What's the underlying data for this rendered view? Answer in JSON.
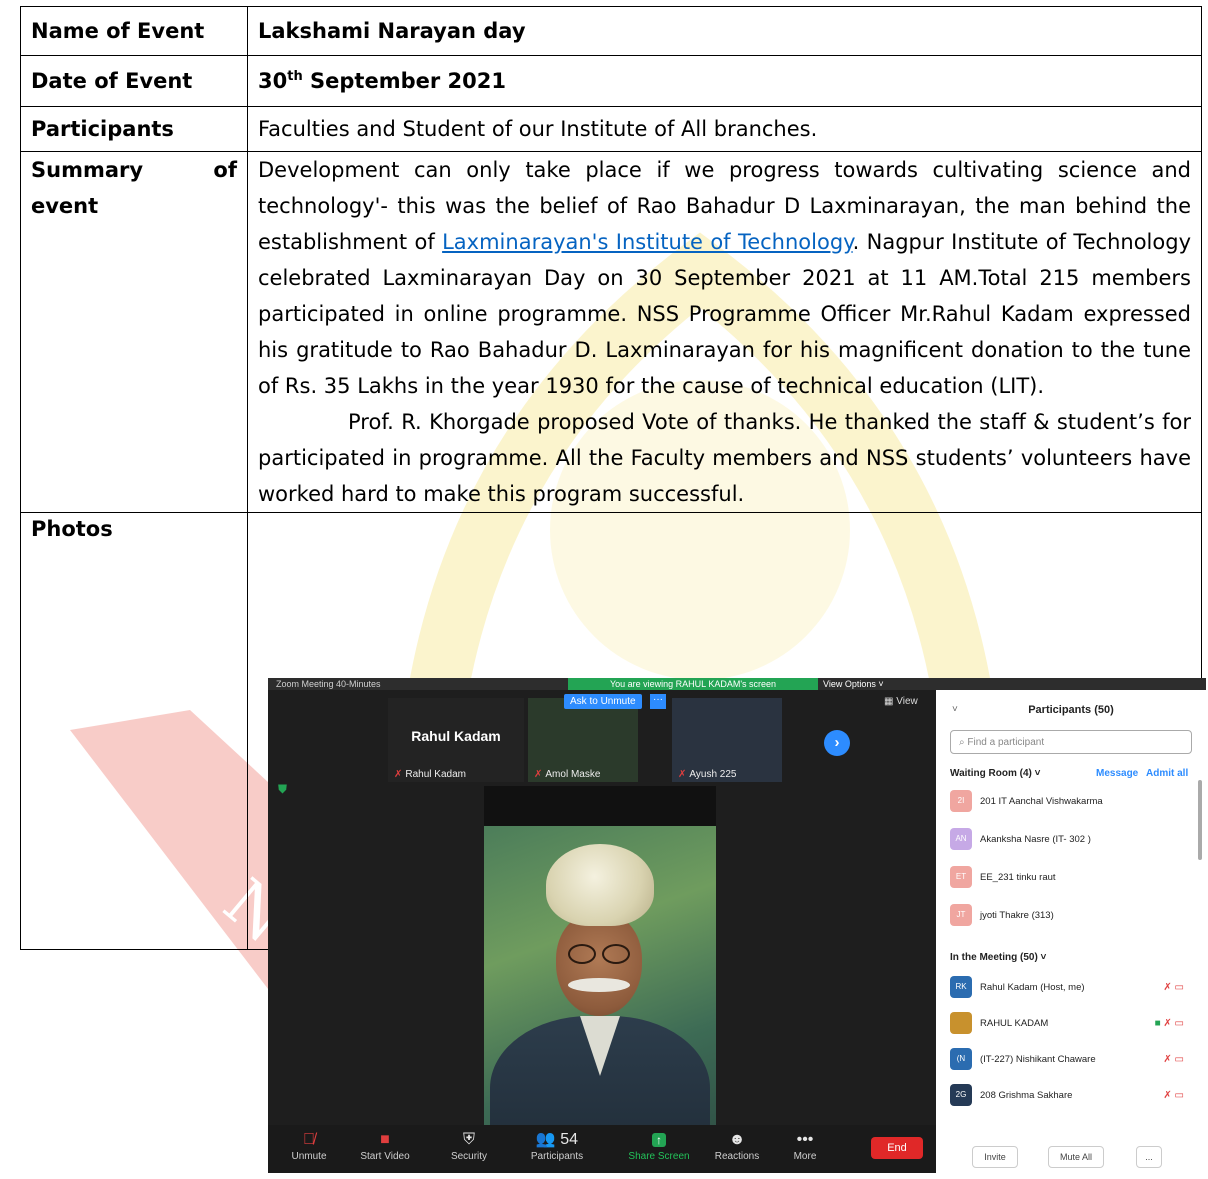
{
  "colors": {
    "watermark_red": "#f5b7b2",
    "watermark_yellow": "#fbf3c8",
    "link": "#0563c1",
    "zoom_blue": "#2d8cff",
    "zoom_green": "#23a454",
    "zoom_end": "#e02828"
  },
  "watermark": {
    "text": "Na"
  },
  "report": {
    "row1": {
      "label": "Name of Event",
      "value": "Lakshami Narayan day"
    },
    "row2": {
      "label": "Date of Event",
      "value_day": "30",
      "value_sup": "th",
      "value_rest": " September 2021"
    },
    "row3": {
      "label": "Participants",
      "value": "Faculties and Student of our Institute of All branches."
    },
    "row4": {
      "label_a": "Summary",
      "label_b": "of",
      "label_c": "event",
      "p1_before": "Development can only take place if we progress towards cultivating science and technology'- this was the belief of Rao Bahadur D Laxminarayan, the man behind the establishment of ",
      "p1_link": "Laxminarayan's Institute of Technology",
      "p1_after": ". Nagpur Institute of Technology celebrated Laxminarayan Day on 30 September 2021 at 11 AM.Total 215 members participated in online programme. NSS Programme Officer Mr.Rahul Kadam expressed his gratitude to Rao Bahadur D. Laxminarayan for his magnificent donation to the tune of Rs. 35 Lakhs in the year 1930 for the cause of technical education (LIT).",
      "p2": "Prof. R. Khorgade proposed Vote of thanks. He thanked the staff & student’s for participated in programme. All the Faculty members and NSS students’ volunteers have worked hard to make this program successful."
    },
    "row5": {
      "label": "Photos"
    }
  },
  "zoom": {
    "title": "Zoom Meeting 40-Minutes",
    "banner": "You are viewing RAHUL KADAM's screen",
    "view_options": "View Options ˅",
    "view_label": "View",
    "ask_unmute": "Ask to Unmute",
    "thumbs": [
      {
        "big": "Rahul Kadam",
        "tag": "Rahul Kadam"
      },
      {
        "big": "",
        "tag": "Amol Maske"
      },
      {
        "big": "",
        "tag": "Ayush 225"
      }
    ],
    "toolbar": [
      {
        "icon": "microphone-muted-icon",
        "glyph": "🎙",
        "label": "Unmute"
      },
      {
        "icon": "video-off-icon",
        "glyph": "■",
        "label": "Start Video"
      },
      {
        "icon": "shield-icon",
        "glyph": "⛨",
        "label": "Security"
      },
      {
        "icon": "participants-icon",
        "glyph": "👥 54",
        "label": "Participants"
      },
      {
        "icon": "share-screen-icon",
        "glyph": "↑",
        "label": "Share Screen"
      },
      {
        "icon": "reactions-icon",
        "glyph": "☻",
        "label": "Reactions"
      },
      {
        "icon": "more-icon",
        "glyph": "•••",
        "label": "More"
      }
    ],
    "end_label": "End",
    "panel": {
      "title": "Participants (50)",
      "search_placeholder": "Find a participant",
      "waiting": "Waiting Room (4)  ˅",
      "message": "Message",
      "admit_all": "Admit all",
      "waiting_list": [
        {
          "initials": "2I",
          "name": "201 IT Aanchal Vishwakarma",
          "color": "#f0a6a0"
        },
        {
          "initials": "AN",
          "name": "Akanksha Nasre (IT- 302 )",
          "color": "#c6a9e6"
        },
        {
          "initials": "ET",
          "name": "EE_231 tinku raut",
          "color": "#f0a6a0"
        },
        {
          "initials": "JT",
          "name": "jyoti Thakre (313)",
          "color": "#f0a6a0"
        }
      ],
      "in_meeting": "In the Meeting (50)  ˅",
      "meeting_list": [
        {
          "initials": "RK",
          "name": "Rahul Kadam (Host, me)",
          "color": "#2b6cb0"
        },
        {
          "initials": "",
          "name": "RAHUL KADAM",
          "color": "#c8912d"
        },
        {
          "initials": "(N",
          "name": "(IT-227) Nishikant Chaware",
          "color": "#2b6cb0"
        },
        {
          "initials": "2G",
          "name": "208 Grishma Sakhare",
          "color": "#253a56"
        }
      ],
      "buttons": [
        "Invite",
        "Mute All",
        "..."
      ]
    }
  }
}
